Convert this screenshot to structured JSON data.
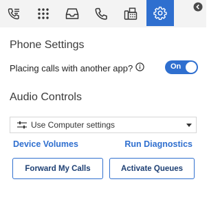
{
  "toolbar": {
    "tabs": [
      {
        "icon": "call-log-icon"
      },
      {
        "icon": "dialpad-icon"
      },
      {
        "icon": "inbox-icon"
      },
      {
        "icon": "phone-icon"
      },
      {
        "icon": "fax-icon"
      },
      {
        "icon": "settings-icon",
        "active": true
      }
    ],
    "collapse_icon": "chevron-left-icon",
    "accent": "#2f6fcf"
  },
  "phone_settings": {
    "title": "Phone Settings",
    "placing_calls_label": "Placing calls with another app?",
    "info_icon": "info-icon",
    "toggle_label": "On",
    "toggle_on": true
  },
  "audio_controls": {
    "title": "Audio Controls",
    "select_icon": "sliders-icon",
    "select_value": "Use Computer settings",
    "device_volumes": "Device Volumes",
    "run_diagnostics": "Run Diagnostics"
  },
  "buttons": {
    "forward": "Forward My Calls",
    "activate": "Activate Queues"
  }
}
